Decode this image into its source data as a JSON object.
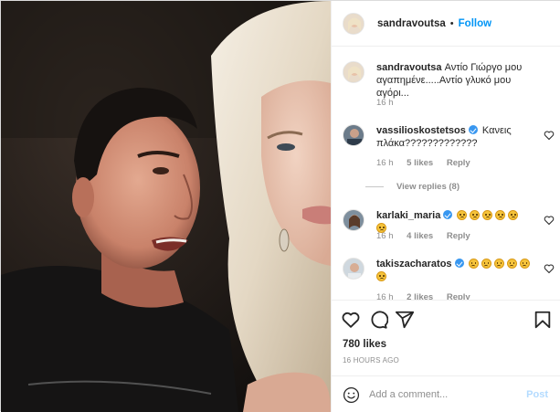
{
  "post": {
    "author": "sandravoutsa",
    "follow_label": "Follow",
    "separator": "•",
    "likes": "780 likes",
    "timestamp": "16 HOURS AGO"
  },
  "comments": [
    {
      "username": "sandravoutsa",
      "text": "Αντίο Γιώργο μου αγαπημένε.....Αντίο γλυκό μου αγόρι...",
      "time": "16 h",
      "verified": false
    },
    {
      "username": "vassilioskostetsos",
      "text": "Κανεις πλάκα?????????????",
      "time": "16 h",
      "likes": "5 likes",
      "reply": "Reply",
      "view_replies": "View replies (8)",
      "verified": true
    },
    {
      "username": "karlaki_maria",
      "text": "",
      "emoji_count": 6,
      "time": "16 h",
      "likes": "4 likes",
      "reply": "Reply",
      "verified": true
    },
    {
      "username": "takiszacharatos",
      "text": "",
      "emoji_count": 6,
      "time": "16 h",
      "likes": "2 likes",
      "reply": "Reply",
      "verified": true
    }
  ],
  "add_comment": {
    "placeholder": "Add a comment...",
    "post_label": "Post"
  },
  "icons": {
    "like": "heart-icon",
    "comment": "comment-icon",
    "share": "share-icon",
    "save": "bookmark-icon",
    "emoji": "smiley-icon",
    "comment_like": "small-heart-icon"
  },
  "colors": {
    "accent": "#0095f6",
    "verified": "#3897f0",
    "muted": "#8e8e8e",
    "post_disabled": "#b3dbff"
  }
}
